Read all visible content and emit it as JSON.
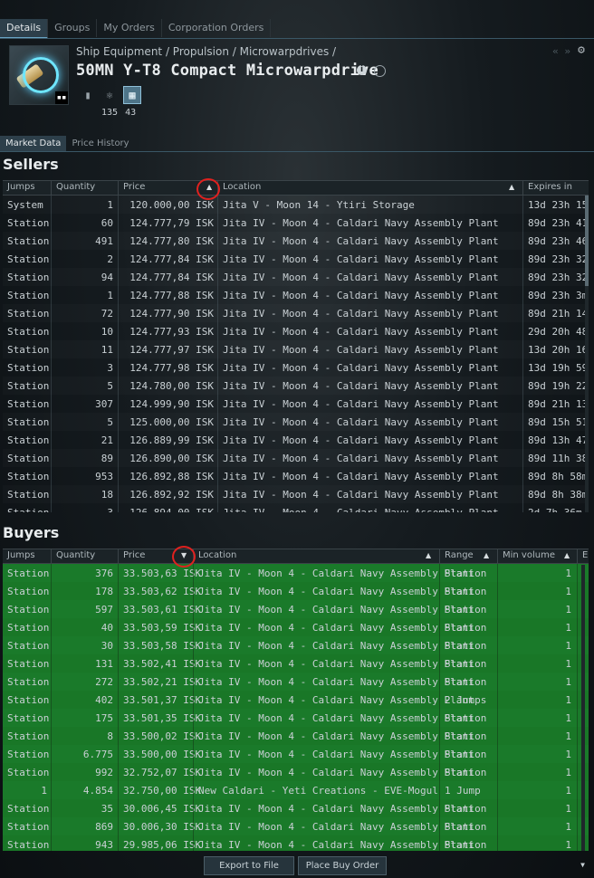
{
  "top_tabs": [
    "Details",
    "Groups",
    "My Orders",
    "Corporation Orders"
  ],
  "breadcrumb": "Ship Equipment / Propulsion / Microwarpdrives /",
  "item_name": "50MN Y-T8 Compact Microwarpdrive",
  "item_thumb_tag": "▪▪",
  "skill_counts": {
    "a": "135",
    "b": "43"
  },
  "sub_tabs": [
    "Market Data",
    "Price History"
  ],
  "sellers": {
    "title": "Sellers",
    "columns": [
      "Jumps",
      "Quantity",
      "Price",
      "Location",
      "Expires in"
    ],
    "rows": [
      [
        "System",
        "1",
        "120.000,00 ISK",
        "Jita V - Moon 14 - Ytiri Storage",
        "13d 23h 15"
      ],
      [
        "Station",
        "60",
        "124.777,79 ISK",
        "Jita IV - Moon 4 - Caldari Navy Assembly Plant",
        "89d 23h 41"
      ],
      [
        "Station",
        "491",
        "124.777,80 ISK",
        "Jita IV - Moon 4 - Caldari Navy Assembly Plant",
        "89d 23h 46"
      ],
      [
        "Station",
        "2",
        "124.777,84 ISK",
        "Jita IV - Moon 4 - Caldari Navy Assembly Plant",
        "89d 23h 32"
      ],
      [
        "Station",
        "94",
        "124.777,84 ISK",
        "Jita IV - Moon 4 - Caldari Navy Assembly Plant",
        "89d 23h 32"
      ],
      [
        "Station",
        "1",
        "124.777,88 ISK",
        "Jita IV - Moon 4 - Caldari Navy Assembly Plant",
        "89d 23h 3m"
      ],
      [
        "Station",
        "72",
        "124.777,90 ISK",
        "Jita IV - Moon 4 - Caldari Navy Assembly Plant",
        "89d 21h 14"
      ],
      [
        "Station",
        "10",
        "124.777,93 ISK",
        "Jita IV - Moon 4 - Caldari Navy Assembly Plant",
        "29d 20h 48"
      ],
      [
        "Station",
        "11",
        "124.777,97 ISK",
        "Jita IV - Moon 4 - Caldari Navy Assembly Plant",
        "13d 20h 16"
      ],
      [
        "Station",
        "3",
        "124.777,98 ISK",
        "Jita IV - Moon 4 - Caldari Navy Assembly Plant",
        "13d 19h 59"
      ],
      [
        "Station",
        "5",
        "124.780,00 ISK",
        "Jita IV - Moon 4 - Caldari Navy Assembly Plant",
        "89d 19h 22"
      ],
      [
        "Station",
        "307",
        "124.999,90 ISK",
        "Jita IV - Moon 4 - Caldari Navy Assembly Plant",
        "89d 21h 13"
      ],
      [
        "Station",
        "5",
        "125.000,00 ISK",
        "Jita IV - Moon 4 - Caldari Navy Assembly Plant",
        "89d 15h 51"
      ],
      [
        "Station",
        "21",
        "126.889,99 ISK",
        "Jita IV - Moon 4 - Caldari Navy Assembly Plant",
        "89d 13h 47"
      ],
      [
        "Station",
        "89",
        "126.890,00 ISK",
        "Jita IV - Moon 4 - Caldari Navy Assembly Plant",
        "89d 11h 38"
      ],
      [
        "Station",
        "953",
        "126.892,88 ISK",
        "Jita IV - Moon 4 - Caldari Navy Assembly Plant",
        "89d 8h 58m"
      ],
      [
        "Station",
        "18",
        "126.892,92 ISK",
        "Jita IV - Moon 4 - Caldari Navy Assembly Plant",
        "89d 8h 38m"
      ],
      [
        "Station",
        "3",
        "126.894,00 ISK",
        "Jita IV - Moon 4 - Caldari Navy Assembly Plant",
        "2d 7h 36m"
      ]
    ]
  },
  "buyers": {
    "title": "Buyers",
    "columns": [
      "Jumps",
      "Quantity",
      "Price",
      "Location",
      "Range",
      "Min volume",
      "E"
    ],
    "rows": [
      [
        "Station",
        "376",
        "33.503,63 ISK",
        "Jita IV - Moon 4 - Caldari Navy Assembly Plant",
        "Station",
        "1"
      ],
      [
        "Station",
        "178",
        "33.503,62 ISK",
        "Jita IV - Moon 4 - Caldari Navy Assembly Plant",
        "Station",
        "1"
      ],
      [
        "Station",
        "597",
        "33.503,61 ISK",
        "Jita IV - Moon 4 - Caldari Navy Assembly Plant",
        "Station",
        "1"
      ],
      [
        "Station",
        "40",
        "33.503,59 ISK",
        "Jita IV - Moon 4 - Caldari Navy Assembly Plant",
        "Station",
        "1"
      ],
      [
        "Station",
        "30",
        "33.503,58 ISK",
        "Jita IV - Moon 4 - Caldari Navy Assembly Plant",
        "Station",
        "1"
      ],
      [
        "Station",
        "131",
        "33.502,41 ISK",
        "Jita IV - Moon 4 - Caldari Navy Assembly Plant",
        "Station",
        "1"
      ],
      [
        "Station",
        "272",
        "33.502,21 ISK",
        "Jita IV - Moon 4 - Caldari Navy Assembly Plant",
        "Station",
        "1"
      ],
      [
        "Station",
        "402",
        "33.501,37 ISK",
        "Jita IV - Moon 4 - Caldari Navy Assembly Plant",
        "2 Jumps",
        "1"
      ],
      [
        "Station",
        "175",
        "33.501,35 ISK",
        "Jita IV - Moon 4 - Caldari Navy Assembly Plant",
        "Station",
        "1"
      ],
      [
        "Station",
        "8",
        "33.500,02 ISK",
        "Jita IV - Moon 4 - Caldari Navy Assembly Plant",
        "Station",
        "1"
      ],
      [
        "Station",
        "6.775",
        "33.500,00 ISK",
        "Jita IV - Moon 4 - Caldari Navy Assembly Plant",
        "Station",
        "1"
      ],
      [
        "Station",
        "992",
        "32.752,07 ISK",
        "Jita IV - Moon 4 - Caldari Navy Assembly Plant",
        "Station",
        "1"
      ],
      [
        "1",
        "4.854",
        "32.750,00 ISK",
        "New Caldari - Yeti Creations - EVE-Mogul",
        "1 Jump",
        "1"
      ],
      [
        "Station",
        "35",
        "30.006,45 ISK",
        "Jita IV - Moon 4 - Caldari Navy Assembly Plant",
        "Station",
        "1"
      ],
      [
        "Station",
        "869",
        "30.006,30 ISK",
        "Jita IV - Moon 4 - Caldari Navy Assembly Plant",
        "Station",
        "1"
      ],
      [
        "Station",
        "943",
        "29.985,06 ISK",
        "Jita IV - Moon 4 - Caldari Navy Assembly Plant",
        "Station",
        "1"
      ]
    ]
  },
  "buttons": {
    "export": "Export to File",
    "place_buy": "Place Buy Order"
  },
  "colors": {
    "buy_row": "#1a7a2a",
    "accent": "#6aa5c4",
    "annotation_circle": "#e0211f"
  },
  "icons": [
    "info-icon",
    "target-icon",
    "settings-gear-icon",
    "blueprint-icon",
    "skill-atom-icon",
    "chip-icon",
    "sort-ascending-icon",
    "sort-descending-icon"
  ]
}
